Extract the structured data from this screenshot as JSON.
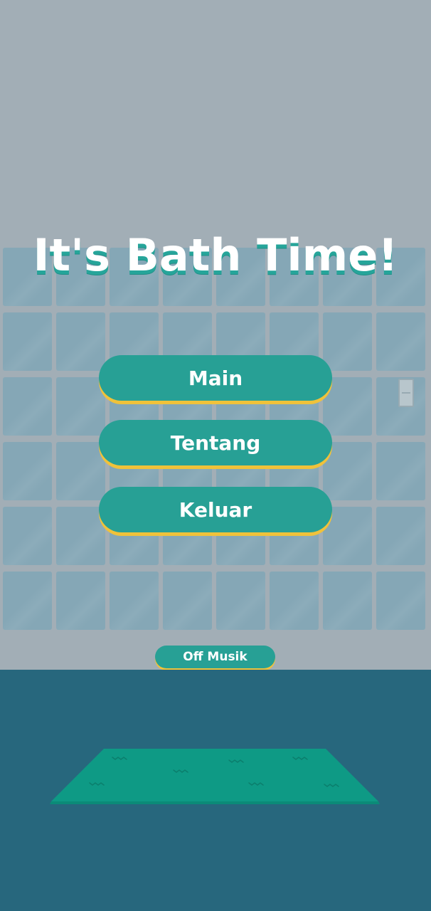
{
  "game": {
    "title": "It's Bath Time!",
    "menu": {
      "play_label": "Main",
      "about_label": "Tentang",
      "exit_label": "Keluar"
    },
    "music_toggle_label": "Off Musik"
  },
  "colors": {
    "wall": "#a2aeb6",
    "tile": "#85a7b6",
    "floor": "#27677d",
    "button": "#27a095",
    "button_edge": "#f0c23a",
    "rug": "#0e9a85",
    "title_shadow": "#26a59a"
  }
}
